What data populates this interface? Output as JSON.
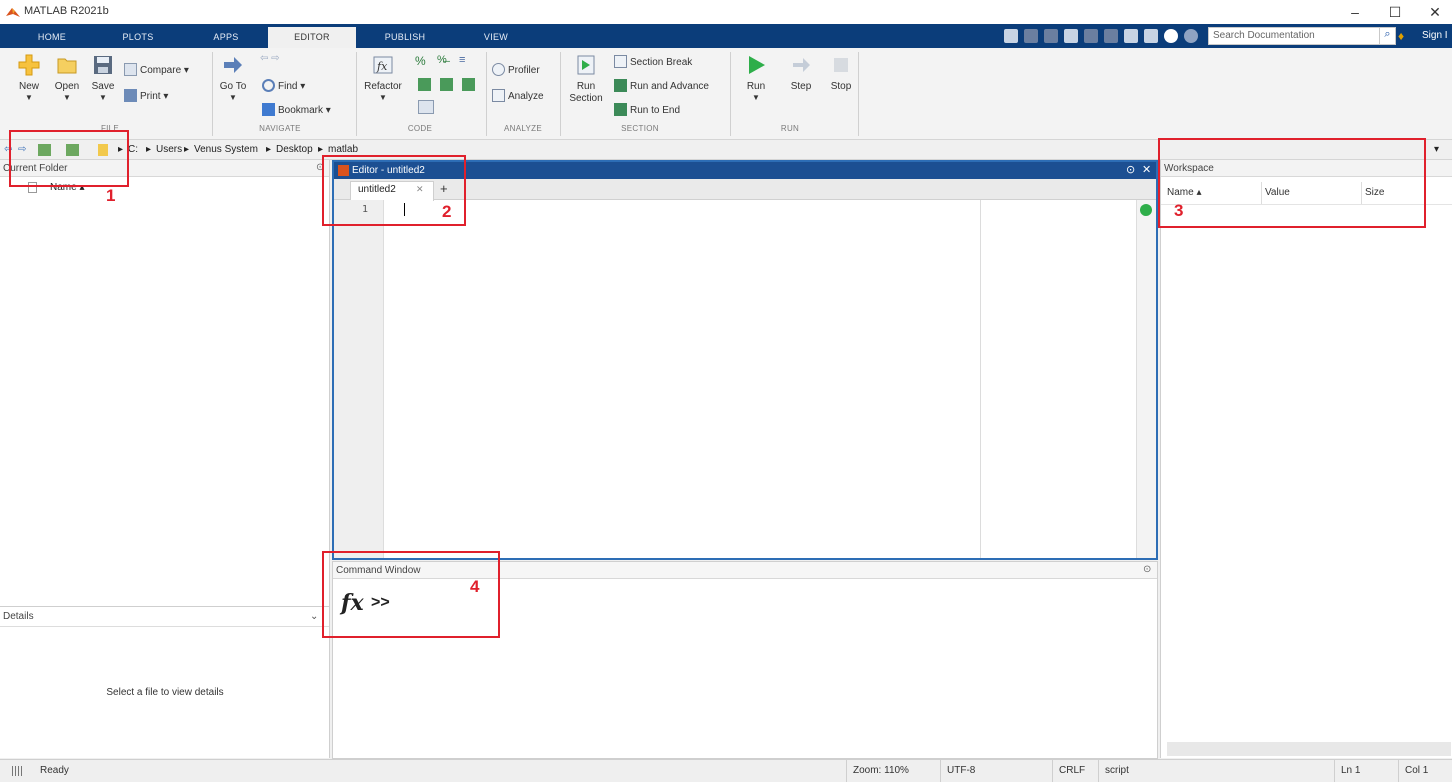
{
  "window": {
    "title": "MATLAB R2021b",
    "controls": {
      "minimize": "–",
      "maximize": "☐",
      "close": "✕"
    }
  },
  "ribbon_tabs": [
    "HOME",
    "PLOTS",
    "APPS",
    "EDITOR",
    "PUBLISH",
    "VIEW"
  ],
  "active_tab": "EDITOR",
  "search": {
    "placeholder": "Search Documentation",
    "signin": "Sign I"
  },
  "ribbon": {
    "file": {
      "label": "FILE",
      "new": "New",
      "open": "Open",
      "save": "Save",
      "compare": "Compare ▾",
      "print": "Print ▾"
    },
    "navigate": {
      "label": "NAVIGATE",
      "goto": "Go To",
      "find": "Find ▾",
      "bookmark": "Bookmark ▾"
    },
    "code": {
      "label": "CODE",
      "refactor": "Refactor"
    },
    "analyze": {
      "label": "ANALYZE",
      "profiler": "Profiler",
      "analyze": "Analyze"
    },
    "section": {
      "label": "SECTION",
      "run_section_1": "Run",
      "run_section_2": "Section",
      "section_break": "Section Break",
      "run_and_advance": "Run and Advance",
      "run_to_end": "Run to End"
    },
    "run": {
      "label": "RUN",
      "run": "Run",
      "step": "Step",
      "stop": "Stop"
    }
  },
  "address": [
    "C:",
    "Users",
    "Venus System",
    "Desktop",
    "matlab"
  ],
  "current_folder": {
    "title": "Current Folder",
    "col_name": "Name ▴"
  },
  "details": {
    "title": "Details",
    "empty": "Select a file to view details"
  },
  "editor": {
    "title": "Editor - untitled2",
    "tab": "untitled2",
    "tab_close": "✕",
    "tab_add": "+",
    "line_numbers": [
      "1"
    ]
  },
  "command_window": {
    "title": "Command Window",
    "fx": "fx",
    "prompt": ">>"
  },
  "workspace": {
    "title": "Workspace",
    "columns": [
      "Name ▴",
      "Value",
      "Size"
    ]
  },
  "annotations": [
    "1",
    "2",
    "3",
    "4"
  ],
  "status": {
    "ready": "Ready",
    "zoom": "Zoom: 110%",
    "encoding": "UTF-8",
    "eol": "CRLF",
    "type": "script",
    "ln": "Ln  1",
    "col": "Col  1"
  },
  "colors": {
    "accent": "#0b3d7a",
    "editor_title": "#1c4f92",
    "annotation": "#e0202c",
    "status_ok": "#2eae4a"
  }
}
